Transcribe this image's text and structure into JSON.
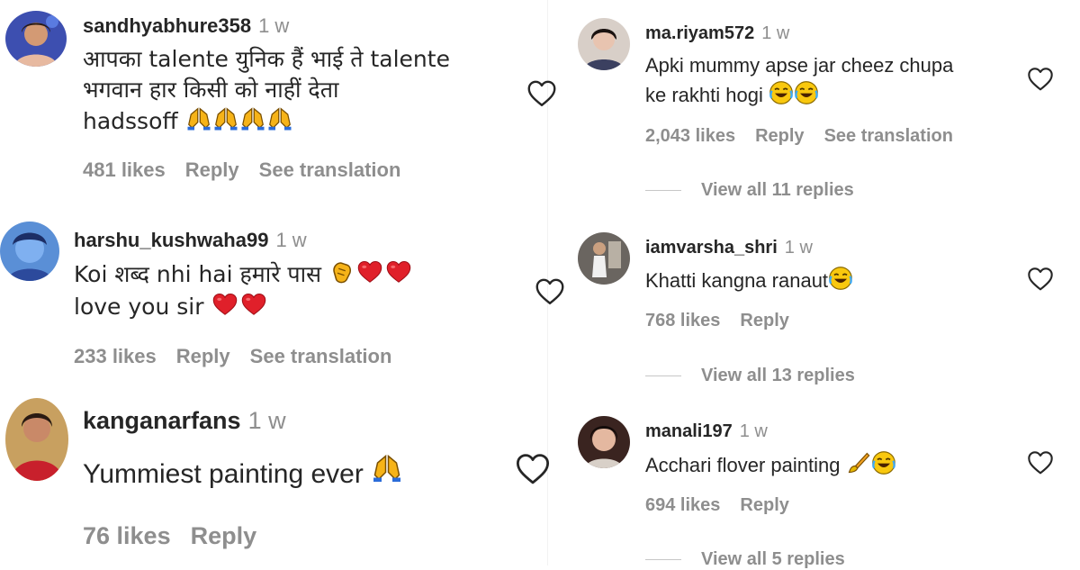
{
  "icons": {
    "like": "heart-outline-icon",
    "pray": "folded-hands-emoji",
    "clap": "clapping-hands-emoji",
    "love": "red-heart-emoji",
    "laugh": "tears-of-joy-emoji",
    "brush": "paintbrush-emoji"
  },
  "comments": [
    {
      "username": "sandhyabhure358",
      "time": "1 w",
      "line1": "आपका talente युनिक हैं भाई ते talente",
      "line2": "भगवान हार किसी को नाहीं देता",
      "line3": "hadssoff",
      "likes": "481 likes",
      "reply": "Reply",
      "translate": "See translation"
    },
    {
      "username": "harshu_kushwaha99",
      "time": "1 w",
      "line1": "Koi शब्द nhi hai हमारे पास",
      "line2": "love you sir",
      "likes": "233 likes",
      "reply": "Reply",
      "translate": "See translation"
    },
    {
      "username": "kanganarfans",
      "time": "1 w",
      "line1": "Yummiest painting ever",
      "likes": "76 likes",
      "reply": "Reply"
    },
    {
      "username": "ma.riyam572",
      "time": "1 w",
      "line1": "Apki mummy apse jar cheez chupa",
      "line2": "ke rakhti hogi",
      "likes": "2,043 likes",
      "reply": "Reply",
      "translate": "See translation",
      "replies": "View all 11 replies"
    },
    {
      "username": "iamvarsha_shri",
      "time": "1 w",
      "line1": "Khatti kangna ranaut",
      "likes": "768 likes",
      "reply": "Reply",
      "replies": "View all 13 replies"
    },
    {
      "username": "manali197",
      "time": "1 w",
      "line1": "Acchari flover painting",
      "likes": "694 likes",
      "reply": "Reply",
      "replies": "View all 5 replies"
    }
  ]
}
